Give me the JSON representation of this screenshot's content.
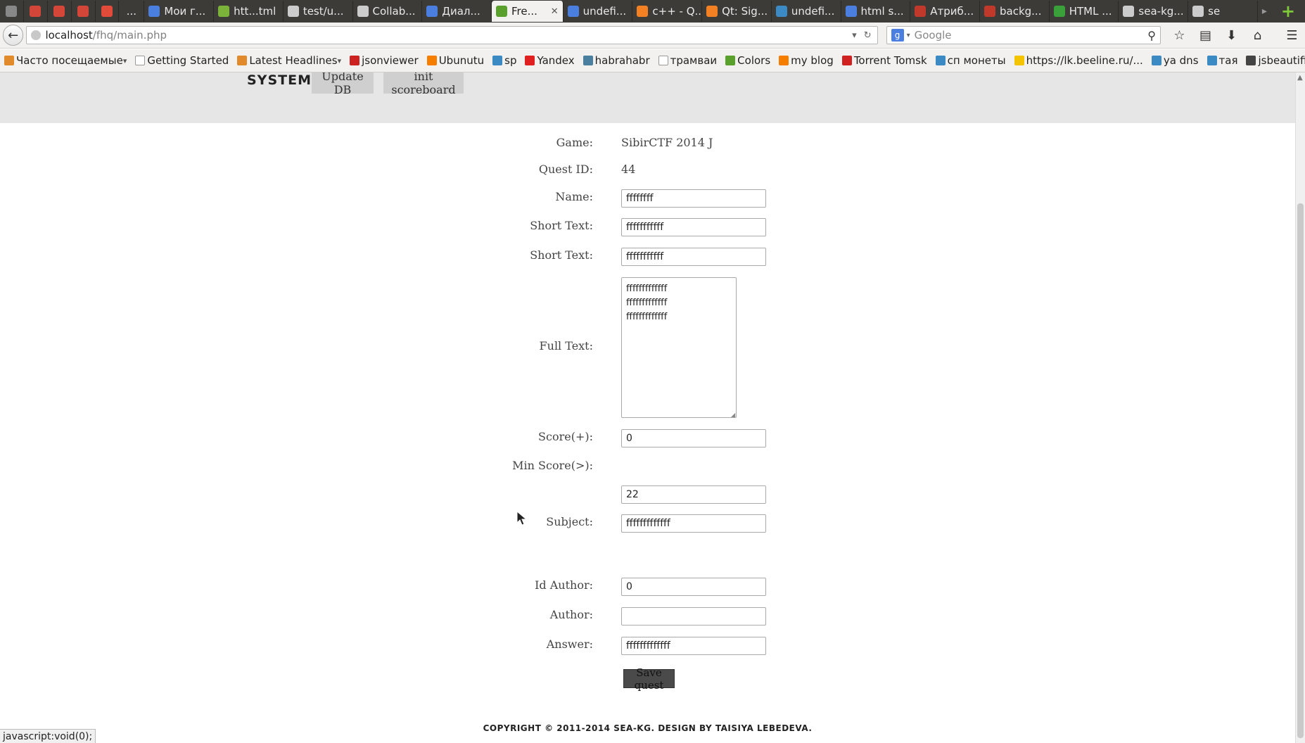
{
  "browser": {
    "tabs": [
      {
        "label": "",
        "icon": "mail-icon",
        "color": "#888888",
        "pinned": true
      },
      {
        "label": "",
        "icon": "gmail-icon",
        "color": "#d44638",
        "pinned": true
      },
      {
        "label": "",
        "icon": "gmail-icon",
        "color": "#d44638",
        "pinned": true
      },
      {
        "label": "",
        "icon": "gmail-icon",
        "color": "#d44638",
        "pinned": true
      },
      {
        "label": "",
        "icon": "music-icon",
        "color": "#e24b3a",
        "pinned": true
      },
      {
        "label": "...",
        "icon": "",
        "color": "",
        "pinned": false,
        "narrow": true
      },
      {
        "label": "Мои г...",
        "icon": "document-icon",
        "color": "#4a7fe0",
        "pinned": false
      },
      {
        "label": "htt...tml",
        "icon": "leaf-icon",
        "color": "#7bb33a",
        "pinned": false
      },
      {
        "label": "test/u...",
        "icon": "github-icon",
        "color": "#cccccc",
        "pinned": false
      },
      {
        "label": "Collab...",
        "icon": "github-icon",
        "color": "#cccccc",
        "pinned": false
      },
      {
        "label": "Диал...",
        "icon": "document-icon",
        "color": "#4a7fe0",
        "pinned": false
      },
      {
        "label": "Fre...",
        "icon": "leaf-icon",
        "color": "#5aa02c",
        "pinned": false,
        "active": true
      },
      {
        "label": "undefi...",
        "icon": "google-icon",
        "color": "#4a7fe0",
        "pinned": false
      },
      {
        "label": "c++ - Q...",
        "icon": "stackoverflow-icon",
        "color": "#f48024",
        "pinned": false
      },
      {
        "label": "Qt: Sig...",
        "icon": "stackoverflow-icon",
        "color": "#f48024",
        "pinned": false
      },
      {
        "label": "undefi...",
        "icon": "translate-icon",
        "color": "#3b8ac4",
        "pinned": false
      },
      {
        "label": "html s...",
        "icon": "google-icon",
        "color": "#4a7fe0",
        "pinned": false
      },
      {
        "label": "Атриб...",
        "icon": "bookmark-icon",
        "color": "#c0392b",
        "pinned": false
      },
      {
        "label": "backg...",
        "icon": "bookmark-icon",
        "color": "#c0392b",
        "pinned": false
      },
      {
        "label": "HTML ...",
        "icon": "check-icon",
        "color": "#3aa03a",
        "pinned": false
      },
      {
        "label": "sea-kg...",
        "icon": "github-icon",
        "color": "#cccccc",
        "pinned": false
      },
      {
        "label": "se",
        "icon": "github-icon",
        "color": "#cccccc",
        "pinned": false
      }
    ],
    "url_host": "localhost",
    "url_path": "/fhq/main.php",
    "search_placeholder": "Google",
    "bookmarks": [
      {
        "label": "Часто посещаемые",
        "icon": "rss-icon",
        "color": "#e08a2c",
        "dropdown": true
      },
      {
        "label": "Getting Started",
        "icon": "page-icon",
        "color": "#dddddd"
      },
      {
        "label": "Latest Headlines",
        "icon": "rss-icon",
        "color": "#e08a2c",
        "dropdown": true
      },
      {
        "label": "jsonviewer",
        "icon": "opera-icon",
        "color": "#cc2222"
      },
      {
        "label": "Ubunutu",
        "icon": "blogger-icon",
        "color": "#f57d00"
      },
      {
        "label": "sp",
        "icon": "plane-icon",
        "color": "#3b8ac4"
      },
      {
        "label": "Yandex",
        "icon": "yandex-icon",
        "color": "#e02020"
      },
      {
        "label": "habrahabr",
        "icon": "habr-icon",
        "color": "#4a7fa0"
      },
      {
        "label": "трамваи",
        "icon": "page-icon",
        "color": "#dddddd"
      },
      {
        "label": "Colors",
        "icon": "palette-icon",
        "color": "#5aa02c"
      },
      {
        "label": "my blog",
        "icon": "blogger-icon",
        "color": "#f57d00"
      },
      {
        "label": "Torrent Tomsk",
        "icon": "star-icon",
        "color": "#d02020"
      },
      {
        "label": "сп монеты",
        "icon": "plane-icon",
        "color": "#3b8ac4"
      },
      {
        "label": "https://lk.beeline.ru/...",
        "icon": "beeline-icon",
        "color": "#f5c400"
      },
      {
        "label": "ya dns",
        "icon": "mail-icon",
        "color": "#3b8ac4"
      },
      {
        "label": "тая",
        "icon": "plane-icon",
        "color": "#3b8ac4"
      },
      {
        "label": "jsbeautifier",
        "icon": "clock-icon",
        "color": "#444444"
      }
    ],
    "status_text": "javascript:void(0);"
  },
  "system": {
    "label": "SYSTEM:",
    "update_db": "Update DB",
    "init_scoreboard": "init scoreboard"
  },
  "form": {
    "game_label": "Game:",
    "game_value": "SibirCTF 2014 J",
    "quest_id_label": "Quest ID:",
    "quest_id_value": "44",
    "name_label": "Name:",
    "name_value": "ffffffff",
    "short_text_label": "Short Text:",
    "short_text_value": "fffffffffff",
    "short_text2_label": "Short Text:",
    "short_text2_value": "fffffffffff",
    "full_text_label": "Full Text:",
    "full_text_value": "fffffffffffff\nfffffffffffff\nfffffffffffff",
    "score_label": "Score(+):",
    "score_value": "0",
    "min_score_label": "Min Score(>):",
    "min_score_value": "22",
    "subject_label": "Subject:",
    "subject_value": "fffffffffffff",
    "id_author_label": "Id Author:",
    "id_author_value": "0",
    "author_label": "Author:",
    "author_value": "",
    "answer_label": "Answer:",
    "answer_value": "fffffffffffff",
    "save_button": "Save quest"
  },
  "footer": {
    "copyright": "COPYRIGHT © 2011-2014 SEA-KG. DESIGN BY TAISIYA LEBEDEVA."
  }
}
